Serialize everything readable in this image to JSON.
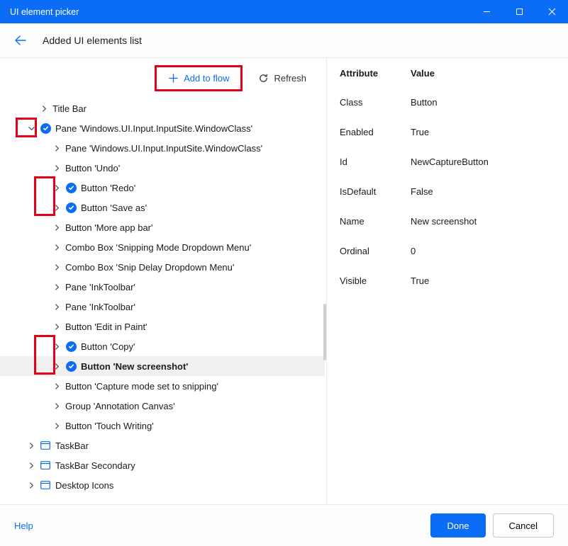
{
  "window": {
    "title": "UI element picker"
  },
  "header": {
    "subtitle": "Added UI elements list"
  },
  "toolbar": {
    "add_label": "Add to flow",
    "refresh_label": "Refresh"
  },
  "tree": {
    "items": [
      {
        "indent": 1,
        "chev": "right",
        "checked": false,
        "label": "Title Bar",
        "selected": false
      },
      {
        "indent": 0,
        "chev": "down",
        "checked": true,
        "label": "Pane 'Windows.UI.Input.InputSite.WindowClass'",
        "selected": false
      },
      {
        "indent": 2,
        "chev": "right",
        "checked": false,
        "label": "Pane 'Windows.UI.Input.InputSite.WindowClass'",
        "selected": false
      },
      {
        "indent": 2,
        "chev": "right",
        "checked": false,
        "label": "Button 'Undo'",
        "selected": false
      },
      {
        "indent": 2,
        "chev": "right",
        "checked": true,
        "label": "Button 'Redo'",
        "selected": false
      },
      {
        "indent": 2,
        "chev": "right",
        "checked": true,
        "label": "Button 'Save as'",
        "selected": false
      },
      {
        "indent": 2,
        "chev": "right",
        "checked": false,
        "label": "Button 'More app bar'",
        "selected": false
      },
      {
        "indent": 2,
        "chev": "right",
        "checked": false,
        "label": "Combo Box 'Snipping Mode Dropdown Menu'",
        "selected": false
      },
      {
        "indent": 2,
        "chev": "right",
        "checked": false,
        "label": "Combo Box 'Snip Delay Dropdown Menu'",
        "selected": false
      },
      {
        "indent": 2,
        "chev": "right",
        "checked": false,
        "label": "Pane 'InkToolbar'",
        "selected": false
      },
      {
        "indent": 2,
        "chev": "right",
        "checked": false,
        "label": "Pane 'InkToolbar'",
        "selected": false
      },
      {
        "indent": 2,
        "chev": "right",
        "checked": false,
        "label": "Button 'Edit in Paint'",
        "selected": false
      },
      {
        "indent": 2,
        "chev": "right",
        "checked": true,
        "label": "Button 'Copy'",
        "selected": false
      },
      {
        "indent": 2,
        "chev": "right",
        "checked": true,
        "label": "Button 'New screenshot'",
        "selected": true
      },
      {
        "indent": 2,
        "chev": "right",
        "checked": false,
        "label": "Button 'Capture mode set to snipping'",
        "selected": false
      },
      {
        "indent": 2,
        "chev": "right",
        "checked": false,
        "label": "Group 'Annotation Canvas'",
        "selected": false
      },
      {
        "indent": 2,
        "chev": "right",
        "checked": false,
        "label": "Button 'Touch Writing'",
        "selected": false
      },
      {
        "indent": 0,
        "chev": "right",
        "checked": false,
        "icon": "window",
        "label": "TaskBar",
        "selected": false
      },
      {
        "indent": 0,
        "chev": "right",
        "checked": false,
        "icon": "window",
        "label": "TaskBar Secondary",
        "selected": false
      },
      {
        "indent": 0,
        "chev": "right",
        "checked": false,
        "icon": "window",
        "label": "Desktop Icons",
        "selected": false
      }
    ]
  },
  "details": {
    "header_attr": "Attribute",
    "header_val": "Value",
    "rows": [
      {
        "attr": "Class",
        "val": "Button"
      },
      {
        "attr": "Enabled",
        "val": "True"
      },
      {
        "attr": "Id",
        "val": "NewCaptureButton"
      },
      {
        "attr": "IsDefault",
        "val": "False"
      },
      {
        "attr": "Name",
        "val": "New screenshot"
      },
      {
        "attr": "Ordinal",
        "val": "0"
      },
      {
        "attr": "Visible",
        "val": "True"
      }
    ]
  },
  "footer": {
    "help": "Help",
    "done": "Done",
    "cancel": "Cancel"
  }
}
